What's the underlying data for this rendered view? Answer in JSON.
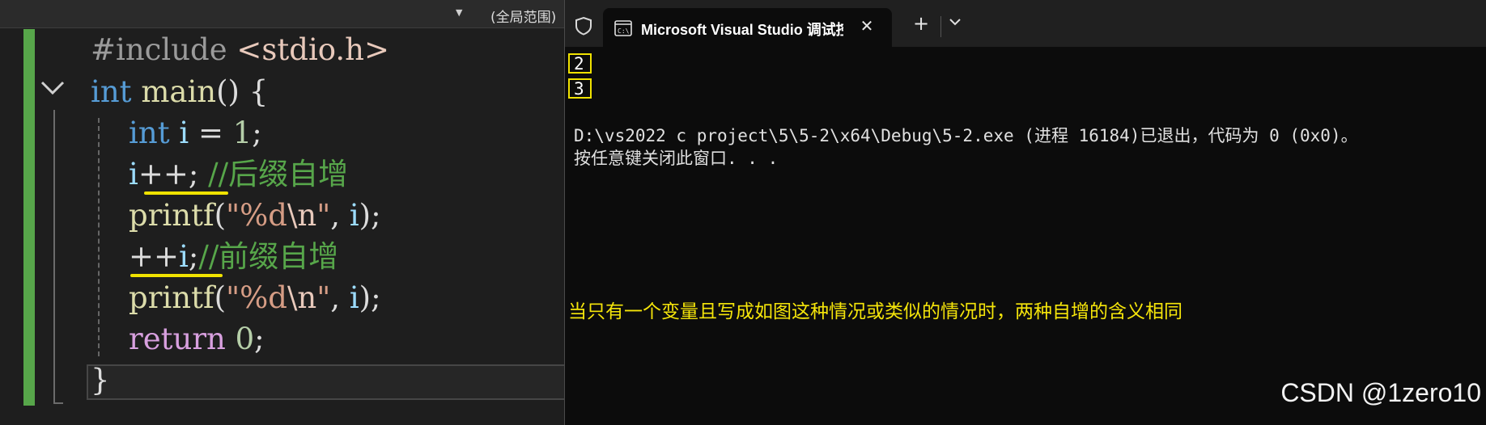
{
  "editor": {
    "scope_label": "(全局范围)",
    "code": {
      "line1": {
        "directive": "#include",
        "header": "<stdio.h>"
      },
      "line2": {
        "type": "int",
        "fn": "main",
        "rest": "() {"
      },
      "line3": {
        "type": "int",
        "var": "i",
        "op": " = ",
        "num": "1",
        "end": ";"
      },
      "line4": {
        "var": "i",
        "op": "++;",
        "comment": "//后缀自增"
      },
      "line5": {
        "fn": "printf",
        "open": "(",
        "fmt": "\"%d",
        "esc": "\\n",
        "quote": "\"",
        "sep": ", ",
        "var": "i",
        "end": ");"
      },
      "line6": {
        "op": "++",
        "var": "i",
        "end": ";",
        "comment": "//前缀自增"
      },
      "line7": {
        "fn": "printf",
        "open": "(",
        "fmt": "\"%d",
        "esc": "\\n",
        "quote": "\"",
        "sep": ", ",
        "var": "i",
        "end": ");"
      },
      "line8": {
        "keyword": "return",
        "num": "0",
        "end": ";"
      },
      "line9": {
        "brace": "}"
      }
    }
  },
  "terminal": {
    "tab_title": "Microsoft Visual Studio 调试控",
    "output_lines": [
      "2",
      "3"
    ],
    "exit_line": "D:\\vs2022 c project\\5\\5-2\\x64\\Debug\\5-2.exe (进程 16184)已退出，代码为 0 (0x0)。",
    "prompt_line": "按任意键关闭此窗口. . .",
    "annotation": "当只有一个变量且写成如图这种情况或类似的情况时，两种自增的含义相同",
    "watermark": "CSDN @1zero10"
  },
  "colors": {
    "highlight_yellow": "#f0e200",
    "change_bar_green": "#57a64a",
    "keyword_blue": "#569cd6",
    "comment_green": "#57a64a"
  },
  "icons": [
    "chevron-down-icon",
    "shield-icon",
    "terminal-app-icon",
    "close-icon",
    "plus-icon",
    "dropdown-icon"
  ]
}
